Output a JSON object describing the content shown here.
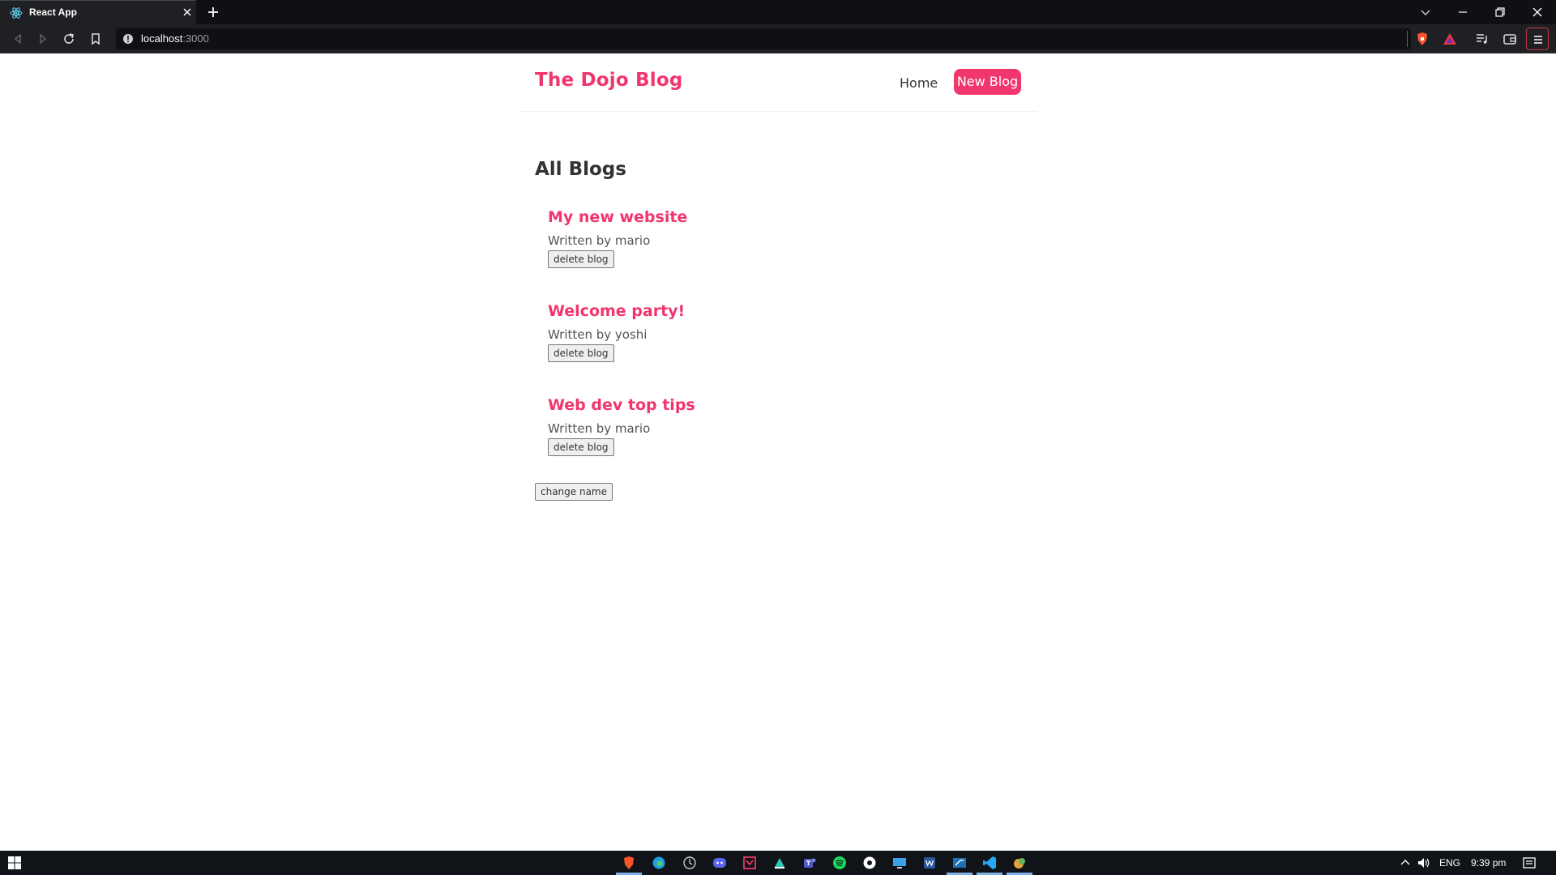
{
  "browser": {
    "tab_title": "React App",
    "url_host": "localhost",
    "url_port": ":3000"
  },
  "navbar": {
    "brand": "The Dojo Blog",
    "links": [
      {
        "label": "Home"
      },
      {
        "label": "New Blog"
      }
    ]
  },
  "home": {
    "title": "All Blogs",
    "blogs": [
      {
        "title": "My new website",
        "author": "Written by mario",
        "delete_label": "delete blog"
      },
      {
        "title": "Welcome party!",
        "author": "Written by yoshi",
        "delete_label": "delete blog"
      },
      {
        "title": "Web dev top tips",
        "author": "Written by mario",
        "delete_label": "delete blog"
      }
    ],
    "change_name_label": "change name"
  },
  "taskbar": {
    "language": "ENG",
    "time": "9:39 pm",
    "pinned_icons": [
      "brave-icon",
      "edge-icon",
      "app-icon",
      "discord-icon",
      "app-icon",
      "app-icon",
      "teams-icon",
      "spotify-icon",
      "app-icon",
      "monitor-icon",
      "word-icon",
      "app-icon",
      "vscode-icon",
      "app-icon"
    ]
  },
  "colors": {
    "accent": "#f1356d",
    "text": "#333333"
  }
}
